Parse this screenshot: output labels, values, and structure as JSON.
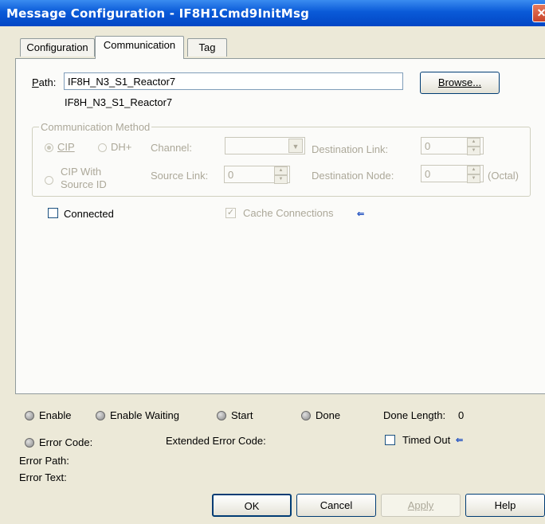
{
  "window": {
    "title": "Message Configuration - IF8H1Cmd9InitMsg",
    "close_glyph": "✕"
  },
  "tabs": [
    {
      "label": "Configuration",
      "active": false
    },
    {
      "label": "Communication",
      "active": true
    },
    {
      "label": "Tag",
      "active": false
    }
  ],
  "path": {
    "label_prefix": "P",
    "label_rest": "ath:",
    "value": "IF8H_N3_S1_Reactor7",
    "resolved": "IF8H_N3_S1_Reactor7",
    "browse_label": "Browse..."
  },
  "comm_method": {
    "title": "Communication Method",
    "cip_label": "CIP",
    "dhplus_label": "DH+",
    "cip_source_label_1": "CIP With",
    "cip_source_label_2": "Source ID",
    "channel_label": "Channel:",
    "channel_value": "",
    "destination_link_label": "Destination Link:",
    "destination_link_value": "0",
    "source_link_label": "Source Link:",
    "source_link_value": "0",
    "destination_node_label": "Destination Node:",
    "destination_node_value": "0",
    "octal_label": "(Octal)"
  },
  "options": {
    "connected_label": "Connected",
    "connected_checked": false,
    "cache_label": "Cache Connections",
    "cache_checked": true,
    "check_glyph": "✓",
    "arrow_glyph": "⇐"
  },
  "status": {
    "enable": "Enable",
    "enable_waiting": "Enable Waiting",
    "start": "Start",
    "done": "Done",
    "done_length_label": "Done Length:",
    "done_length_value": "0",
    "error_code": "Error Code:",
    "extended_error_code": "Extended Error Code:",
    "timed_out": "Timed Out",
    "error_path": "Error Path:",
    "error_text": "Error Text:"
  },
  "buttons": {
    "ok": "OK",
    "cancel": "Cancel",
    "apply": "Apply",
    "help": "Help"
  },
  "colors": {
    "title_bar": "#0a5ad8",
    "dialog_bg": "#ece9d8",
    "panel_bg": "#fbfbf9",
    "disabled_text": "#aca899",
    "arrow": "#1f4fc0"
  }
}
